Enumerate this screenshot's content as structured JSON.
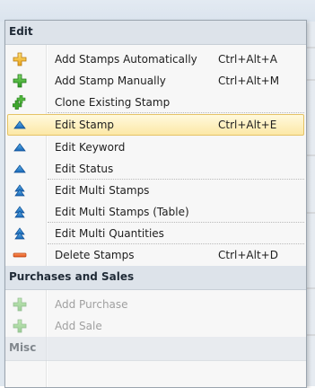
{
  "menu": {
    "sections": [
      {
        "title": "Edit"
      },
      {
        "title": "Purchases and Sales"
      },
      {
        "title": "Misc"
      }
    ],
    "edit_items": [
      {
        "label": "Add Stamps Automatically",
        "shortcut": "Ctrl+Alt+A",
        "icon": "plus-yellow-icon"
      },
      {
        "label": "Add Stamp Manually",
        "shortcut": "Ctrl+Alt+M",
        "icon": "plus-green-icon"
      },
      {
        "label": "Clone Existing Stamp",
        "shortcut": "",
        "icon": "clone-plus-icon"
      },
      {
        "label": "Edit Stamp",
        "shortcut": "Ctrl+Alt+E",
        "icon": "edit-blue-icon",
        "highlighted": true
      },
      {
        "label": "Edit Keyword",
        "shortcut": "",
        "icon": "edit-blue-icon"
      },
      {
        "label": "Edit Status",
        "shortcut": "",
        "icon": "edit-blue-icon"
      },
      {
        "label": "Edit Multi Stamps",
        "shortcut": "",
        "icon": "edit-multi-icon"
      },
      {
        "label": "Edit Multi Stamps (Table)",
        "shortcut": "",
        "icon": "edit-multi-icon"
      },
      {
        "label": "Edit Multi Quantities",
        "shortcut": "",
        "icon": "edit-multi-icon"
      },
      {
        "label": "Delete Stamps",
        "shortcut": "Ctrl+Alt+D",
        "icon": "minus-orange-icon"
      }
    ],
    "purchase_items": [
      {
        "label": "Add Purchase",
        "icon": "plus-green-icon",
        "disabled": true
      },
      {
        "label": "Add Sale",
        "icon": "plus-green-icon",
        "disabled": true
      }
    ]
  },
  "colors": {
    "highlight_top": "#fff9dd",
    "highlight_bottom": "#fce8a6",
    "highlight_border": "#e5c365",
    "header_bg": "#dde3ea",
    "disabled_text": "#a0a0a0"
  }
}
